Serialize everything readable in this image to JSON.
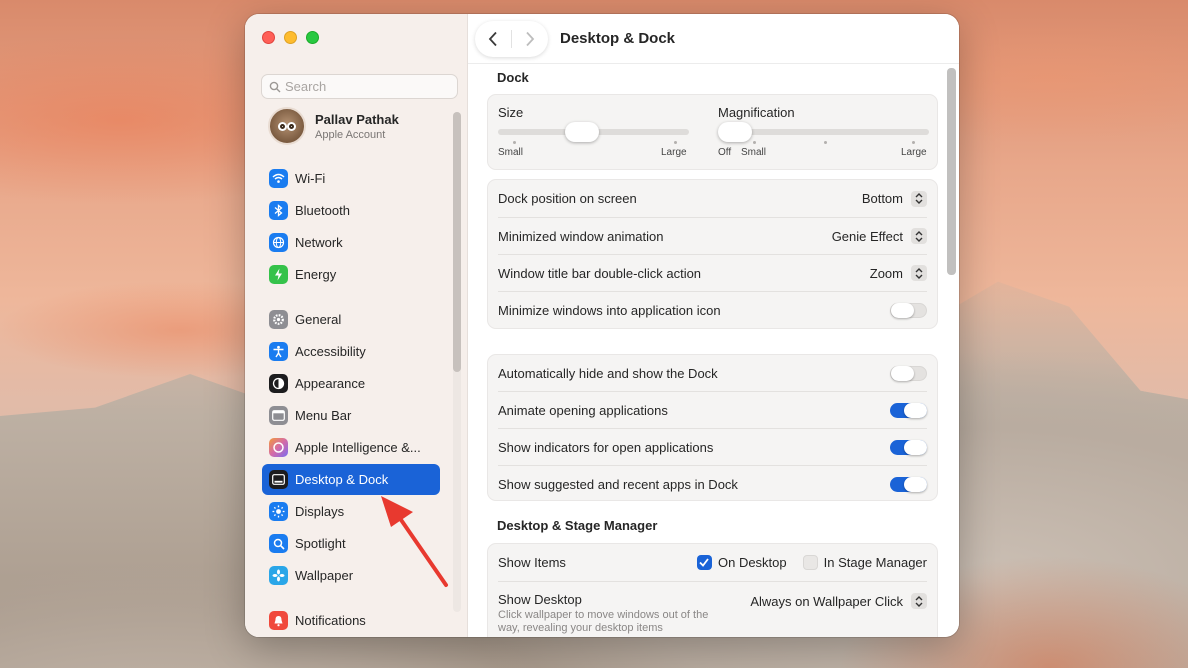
{
  "window": {
    "title": "Desktop & Dock"
  },
  "sidebar": {
    "search_placeholder": "Search",
    "account": {
      "name": "Pallav Pathak",
      "subtitle": "Apple Account"
    },
    "items": [
      {
        "label": "Wi-Fi",
        "icon": "wifi-icon",
        "color": "#1a7cf0"
      },
      {
        "label": "Bluetooth",
        "icon": "bluetooth-icon",
        "color": "#1a7cf0"
      },
      {
        "label": "Network",
        "icon": "network-icon",
        "color": "#1a7cf0"
      },
      {
        "label": "Energy",
        "icon": "energy-icon",
        "color": "#35c24a"
      },
      {
        "label": "General",
        "icon": "gear-icon",
        "color": "#8e8e93"
      },
      {
        "label": "Accessibility",
        "icon": "accessibility-icon",
        "color": "#1a7cf0"
      },
      {
        "label": "Appearance",
        "icon": "appearance-icon",
        "color": "#1c1c1e"
      },
      {
        "label": "Menu Bar",
        "icon": "menu-bar-icon",
        "color": "#8e8e93"
      },
      {
        "label": "Apple Intelligence &...",
        "icon": "apple-intelligence-icon",
        "color": "#d46aa8"
      },
      {
        "label": "Desktop & Dock",
        "icon": "desktop-dock-icon",
        "color": "#1c1c1e",
        "active": true
      },
      {
        "label": "Displays",
        "icon": "displays-icon",
        "color": "#1a7cf0"
      },
      {
        "label": "Spotlight",
        "icon": "spotlight-icon",
        "color": "#1a7cf0"
      },
      {
        "label": "Wallpaper",
        "icon": "wallpaper-icon",
        "color": "#2aa6e8"
      },
      {
        "label": "Notifications",
        "icon": "notifications-icon",
        "color": "#f0493c"
      }
    ]
  },
  "dock": {
    "section_title": "Dock",
    "size": {
      "label": "Size",
      "min_label": "Small",
      "max_label": "Large",
      "value": 0.4
    },
    "magnification": {
      "label": "Magnification",
      "off_label": "Off",
      "min_label": "Small",
      "max_label": "Large",
      "value": 0.0
    },
    "position": {
      "label": "Dock position on screen",
      "value": "Bottom"
    },
    "minimize_animation": {
      "label": "Minimized window animation",
      "value": "Genie Effect"
    },
    "title_bar_action": {
      "label": "Window title bar double-click action",
      "value": "Zoom"
    },
    "minimize_into_icon": {
      "label": "Minimize windows into application icon",
      "on": false
    },
    "auto_hide": {
      "label": "Automatically hide and show the Dock",
      "on": false
    },
    "animate_opening": {
      "label": "Animate opening applications",
      "on": true
    },
    "show_indicators": {
      "label": "Show indicators for open applications",
      "on": true
    },
    "show_suggested": {
      "label": "Show suggested and recent apps in Dock",
      "on": true
    }
  },
  "stage_manager": {
    "section_title": "Desktop & Stage Manager",
    "show_items": {
      "label": "Show Items",
      "on_desktop": "On Desktop",
      "in_stage_manager": "In Stage Manager"
    },
    "show_desktop": {
      "label": "Show Desktop",
      "description": "Click wallpaper to move windows out of the way, revealing your desktop items",
      "value": "Always on Wallpaper Click"
    }
  },
  "colors": {
    "accent": "#1a63d7",
    "annotation_arrow": "#e8392f"
  }
}
